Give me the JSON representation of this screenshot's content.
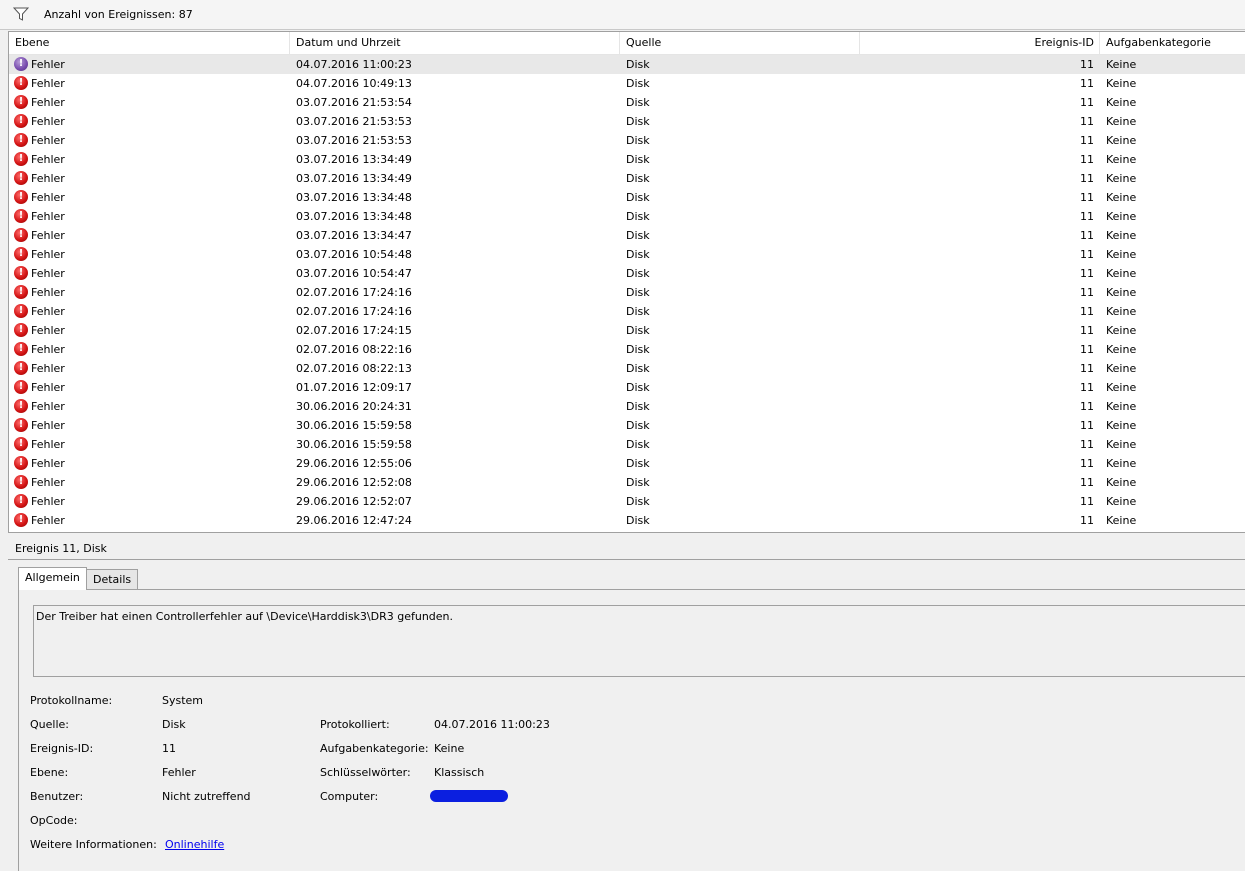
{
  "filter": {
    "icon": "funnel-icon",
    "text": "Anzahl von Ereignissen: 87"
  },
  "columns": {
    "level": "Ebene",
    "datetime": "Datum und Uhrzeit",
    "source": "Quelle",
    "event_id": "Ereignis-ID",
    "task_category": "Aufgabenkategorie"
  },
  "events": [
    {
      "level": "Fehler",
      "datetime": "04.07.2016 11:00:23",
      "source": "Disk",
      "event_id": "11",
      "task_category": "Keine",
      "selected": true
    },
    {
      "level": "Fehler",
      "datetime": "04.07.2016 10:49:13",
      "source": "Disk",
      "event_id": "11",
      "task_category": "Keine"
    },
    {
      "level": "Fehler",
      "datetime": "03.07.2016 21:53:54",
      "source": "Disk",
      "event_id": "11",
      "task_category": "Keine"
    },
    {
      "level": "Fehler",
      "datetime": "03.07.2016 21:53:53",
      "source": "Disk",
      "event_id": "11",
      "task_category": "Keine"
    },
    {
      "level": "Fehler",
      "datetime": "03.07.2016 21:53:53",
      "source": "Disk",
      "event_id": "11",
      "task_category": "Keine"
    },
    {
      "level": "Fehler",
      "datetime": "03.07.2016 13:34:49",
      "source": "Disk",
      "event_id": "11",
      "task_category": "Keine"
    },
    {
      "level": "Fehler",
      "datetime": "03.07.2016 13:34:49",
      "source": "Disk",
      "event_id": "11",
      "task_category": "Keine"
    },
    {
      "level": "Fehler",
      "datetime": "03.07.2016 13:34:48",
      "source": "Disk",
      "event_id": "11",
      "task_category": "Keine"
    },
    {
      "level": "Fehler",
      "datetime": "03.07.2016 13:34:48",
      "source": "Disk",
      "event_id": "11",
      "task_category": "Keine"
    },
    {
      "level": "Fehler",
      "datetime": "03.07.2016 13:34:47",
      "source": "Disk",
      "event_id": "11",
      "task_category": "Keine"
    },
    {
      "level": "Fehler",
      "datetime": "03.07.2016 10:54:48",
      "source": "Disk",
      "event_id": "11",
      "task_category": "Keine"
    },
    {
      "level": "Fehler",
      "datetime": "03.07.2016 10:54:47",
      "source": "Disk",
      "event_id": "11",
      "task_category": "Keine"
    },
    {
      "level": "Fehler",
      "datetime": "02.07.2016 17:24:16",
      "source": "Disk",
      "event_id": "11",
      "task_category": "Keine"
    },
    {
      "level": "Fehler",
      "datetime": "02.07.2016 17:24:16",
      "source": "Disk",
      "event_id": "11",
      "task_category": "Keine"
    },
    {
      "level": "Fehler",
      "datetime": "02.07.2016 17:24:15",
      "source": "Disk",
      "event_id": "11",
      "task_category": "Keine"
    },
    {
      "level": "Fehler",
      "datetime": "02.07.2016 08:22:16",
      "source": "Disk",
      "event_id": "11",
      "task_category": "Keine"
    },
    {
      "level": "Fehler",
      "datetime": "02.07.2016 08:22:13",
      "source": "Disk",
      "event_id": "11",
      "task_category": "Keine"
    },
    {
      "level": "Fehler",
      "datetime": "01.07.2016 12:09:17",
      "source": "Disk",
      "event_id": "11",
      "task_category": "Keine"
    },
    {
      "level": "Fehler",
      "datetime": "30.06.2016 20:24:31",
      "source": "Disk",
      "event_id": "11",
      "task_category": "Keine"
    },
    {
      "level": "Fehler",
      "datetime": "30.06.2016 15:59:58",
      "source": "Disk",
      "event_id": "11",
      "task_category": "Keine"
    },
    {
      "level": "Fehler",
      "datetime": "30.06.2016 15:59:58",
      "source": "Disk",
      "event_id": "11",
      "task_category": "Keine"
    },
    {
      "level": "Fehler",
      "datetime": "29.06.2016 12:55:06",
      "source": "Disk",
      "event_id": "11",
      "task_category": "Keine"
    },
    {
      "level": "Fehler",
      "datetime": "29.06.2016 12:52:08",
      "source": "Disk",
      "event_id": "11",
      "task_category": "Keine"
    },
    {
      "level": "Fehler",
      "datetime": "29.06.2016 12:52:07",
      "source": "Disk",
      "event_id": "11",
      "task_category": "Keine"
    },
    {
      "level": "Fehler",
      "datetime": "29.06.2016 12:47:24",
      "source": "Disk",
      "event_id": "11",
      "task_category": "Keine"
    }
  ],
  "detail": {
    "title": "Ereignis 11, Disk",
    "tabs": {
      "general": "Allgemein",
      "details": "Details"
    },
    "message": "Der Treiber hat einen Controllerfehler auf \\Device\\Harddisk3\\DR3 gefunden.",
    "props": {
      "log_name_label": "Protokollname:",
      "log_name": "System",
      "source_label": "Quelle:",
      "source": "Disk",
      "logged_label": "Protokolliert:",
      "logged": "04.07.2016 11:00:23",
      "event_id_label": "Ereignis-ID:",
      "event_id": "11",
      "task_category_label": "Aufgabenkategorie:",
      "task_category": "Keine",
      "level_label": "Ebene:",
      "level": "Fehler",
      "keywords_label": "Schlüsselwörter:",
      "keywords": "Klassisch",
      "user_label": "Benutzer:",
      "user": "Nicht zutreffend",
      "computer_label": "Computer:",
      "opcode_label": "OpCode:",
      "more_info_label": "Weitere Informationen:",
      "more_info_link": "Onlinehilfe"
    }
  },
  "colors": {
    "error_red": "#d41515",
    "selected_row": "#e8e8e8",
    "redaction_blue": "#0b1fe0",
    "link": "#0000ee"
  }
}
